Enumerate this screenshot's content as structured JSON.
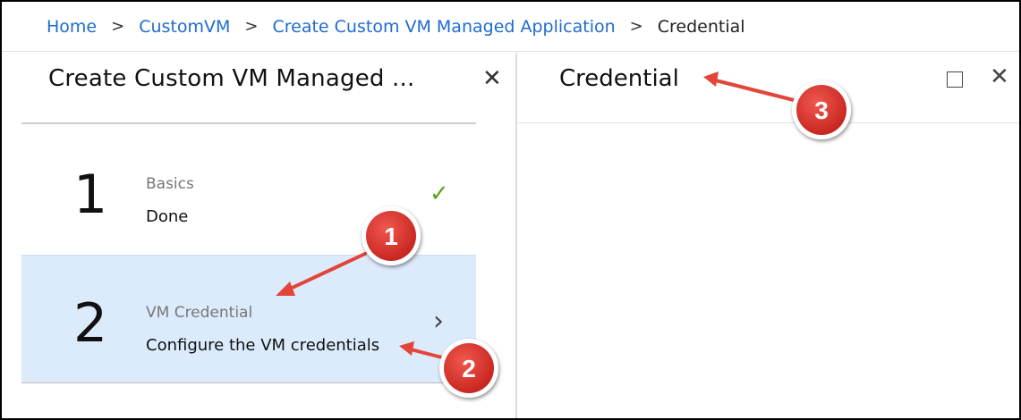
{
  "breadcrumb": {
    "items": [
      "Home",
      "CustomVM",
      "Create Custom VM Managed Application"
    ],
    "current": "Credential",
    "separator": ">"
  },
  "left_blade": {
    "title": "Create Custom VM Managed ...",
    "close_glyph": "✕",
    "steps": [
      {
        "number": "1",
        "label": "Basics",
        "value": "Done",
        "status_icon": "check-icon",
        "status_glyph": "✓"
      },
      {
        "number": "2",
        "label": "VM Credential",
        "value": "Configure the VM credentials",
        "nav_icon": "chevron-right-icon",
        "nav_glyph": "›"
      }
    ]
  },
  "right_blade": {
    "title": "Credential",
    "close_glyph": "✕"
  },
  "callouts": [
    "1",
    "2",
    "3"
  ],
  "colors": {
    "link": "#1f6bd1",
    "selected_step_bg": "#dcebfb",
    "check": "#5aa21c",
    "badge_red": "#d8322b",
    "arrow": "#e2453a"
  }
}
